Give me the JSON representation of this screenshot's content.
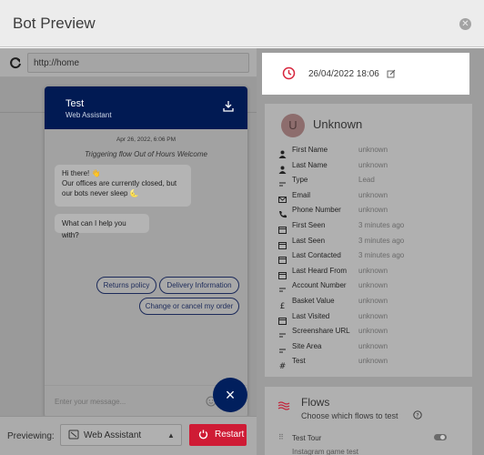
{
  "header": {
    "title": "Bot Preview",
    "close_icon": "close-icon"
  },
  "preview": {
    "url": "http://home",
    "widget": {
      "bot_name": "Test",
      "bot_subtitle": "Web Assistant",
      "date": "Apr 26, 2022, 6:06 PM",
      "flow_trigger": "Triggering flow Out of Hours Welcome",
      "message1_line1": "Hi there! 👋",
      "message1_line2": "Our offices are currently closed, but",
      "message1_line3": "our bots never sleep 🌜",
      "message2": "What can I help you with?",
      "quick_replies": [
        "Returns policy",
        "Delivery Information",
        "Change or cancel my order"
      ],
      "input_placeholder": "Enter your message..."
    },
    "fab_label": "×",
    "footer": {
      "previewing_label": "Previewing:",
      "channel": "Web Assistant",
      "restart_label": "Restart"
    }
  },
  "contact": {
    "timestamp": "26/04/2022 18:06",
    "avatar_initial": "U",
    "name": "Unknown",
    "fields": [
      {
        "icon": "person-icon",
        "label": "First Name",
        "value": "unknown"
      },
      {
        "icon": "person-icon",
        "label": "Last Name",
        "value": "unknown"
      },
      {
        "icon": "lines-icon",
        "label": "Type",
        "value": "Lead"
      },
      {
        "icon": "mail-icon",
        "label": "Email",
        "value": "unknown"
      },
      {
        "icon": "phone-icon",
        "label": "Phone Number",
        "value": "unknown"
      },
      {
        "icon": "calendar-icon",
        "label": "First Seen",
        "value": "3 minutes ago"
      },
      {
        "icon": "calendar-icon",
        "label": "Last Seen",
        "value": "3 minutes ago"
      },
      {
        "icon": "calendar-icon",
        "label": "Last Contacted",
        "value": "3 minutes ago"
      },
      {
        "icon": "calendar-icon",
        "label": "Last Heard From",
        "value": "unknown"
      },
      {
        "icon": "lines-icon",
        "label": "Account Number",
        "value": "unknown"
      },
      {
        "icon": "pound-icon",
        "label": "Basket Value",
        "value": "unknown"
      },
      {
        "icon": "calendar-icon",
        "label": "Last Visited",
        "value": "unknown"
      },
      {
        "icon": "lines-icon",
        "label": "Screenshare URL",
        "value": "unknown"
      },
      {
        "icon": "lines-icon",
        "label": "Site Area",
        "value": "unknown"
      },
      {
        "icon": "hash-icon",
        "label": "Test",
        "value": "unknown"
      }
    ]
  },
  "flows": {
    "title": "Flows",
    "subtitle": "Choose which flows to test",
    "items": [
      "Test Tour",
      "Instagram game test"
    ]
  },
  "colors": {
    "accent_red": "#cf1b35",
    "navy": "#011a53"
  }
}
